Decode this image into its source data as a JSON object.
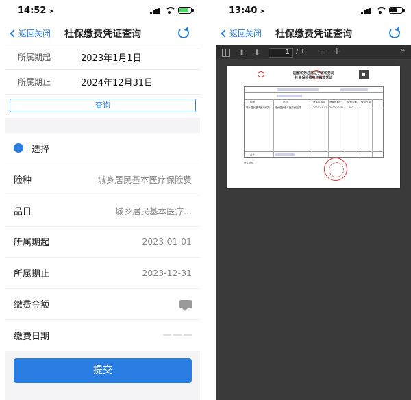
{
  "left": {
    "status": {
      "time": "14:52",
      "battery_color": "#4cd964"
    },
    "nav": {
      "back": "返回",
      "close": "关闭",
      "title": "社保缴费凭证查询"
    },
    "filters": [
      {
        "label": "所属期起",
        "value": "2023年1月1日"
      },
      {
        "label": "所属期止",
        "value": "2024年12月31日"
      }
    ],
    "query_button": "查询",
    "select_label": "选择",
    "details": [
      {
        "label": "险种",
        "value": "城乡居民基本医疗保险费"
      },
      {
        "label": "品目",
        "value": "城乡居民基本医疗..."
      },
      {
        "label": "所属期起",
        "value": "2023-01-01"
      },
      {
        "label": "所属期止",
        "value": "2023-12-31"
      },
      {
        "label": "缴费金额",
        "value": ""
      },
      {
        "label": "缴费日期",
        "value": ""
      }
    ],
    "submit_button": "提交"
  },
  "right": {
    "status": {
      "time": "13:40",
      "battery_color": "#111111"
    },
    "nav": {
      "back": "返回",
      "close": "关闭",
      "title": "社保缴费凭证查询"
    },
    "toolbar": {
      "page_current": "1",
      "page_total": "/ 1",
      "minus": "−",
      "plus": "+",
      "more": "»",
      "up": "⬆",
      "down": "⬇"
    },
    "pdf": {
      "title_line1": "国家税务总局辽宁省税务局",
      "title_line2": "社会保险费电子缴款凭证",
      "col_headers": [
        "险种",
        "品目",
        "所属时期起",
        "所属时期止",
        "缴费金额",
        "缴费日期"
      ],
      "row_1": [
        "城乡居民基本医疗保险",
        "城乡居民基本医疗保险费",
        "2023-01-01",
        "2023-12-31",
        "380"
      ],
      "total_label": "合计",
      "note_label": "备注说明："
    }
  },
  "colors": {
    "accent": "#2a7de1",
    "page_bg": "#f4f4f6",
    "viewer_bg": "#3a3a3a",
    "stamp": "#d33333"
  }
}
